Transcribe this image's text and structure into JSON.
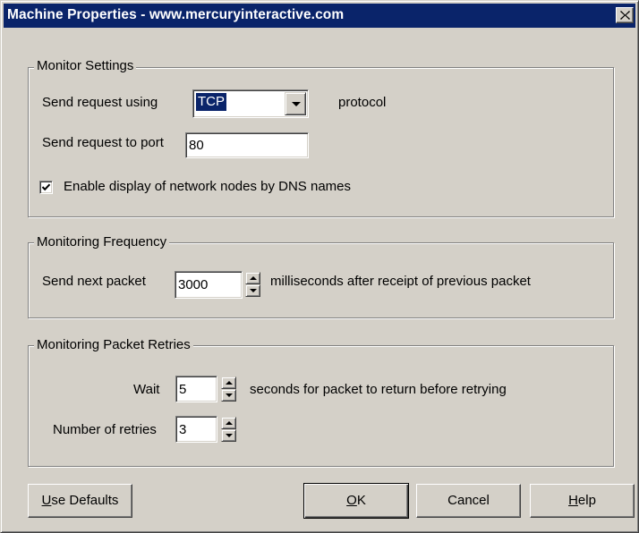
{
  "window": {
    "title": "Machine Properties - www.mercuryinteractive.com",
    "close_icon": "close-icon"
  },
  "monitor_settings": {
    "legend": "Monitor Settings",
    "send_using_label": "Send request using",
    "protocol_value": "TCP",
    "protocol_suffix": "protocol",
    "port_label": "Send request to port",
    "port_value": "80",
    "dns_checkbox_label": "Enable display of network nodes by DNS names",
    "dns_checked": true
  },
  "monitoring_frequency": {
    "legend": "Monitoring Frequency",
    "send_next_label": "Send next packet",
    "packet_interval": "3000",
    "interval_suffix": "milliseconds after receipt of previous packet"
  },
  "packet_retries": {
    "legend": "Monitoring Packet Retries",
    "wait_label": "Wait",
    "wait_value": "5",
    "wait_suffix": "seconds for packet to return before retrying",
    "retries_label": "Number of retries",
    "retries_value": "3"
  },
  "buttons": {
    "use_defaults_accel": "U",
    "use_defaults_rest": "se Defaults",
    "ok_accel": "O",
    "ok_rest": "K",
    "cancel": "Cancel",
    "help_accel": "H",
    "help_rest": "elp"
  },
  "colors": {
    "title_bar": "#0a246a",
    "dialog_face": "#d4d0c8"
  }
}
